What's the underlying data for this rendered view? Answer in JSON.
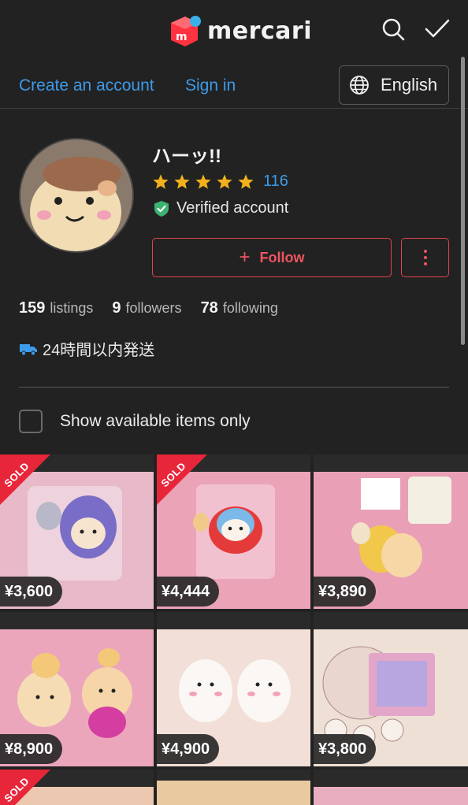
{
  "header": {
    "brand": "mercari",
    "icons": [
      "search-icon",
      "checkmark-icon"
    ]
  },
  "auth": {
    "create_account": "Create an account",
    "sign_in": "Sign in",
    "language": "English"
  },
  "profile": {
    "username": "ハーッ!!",
    "rating_stars": 5,
    "rating_count": "116",
    "verified": "Verified account",
    "follow": "Follow",
    "stats": {
      "listings_num": "159",
      "listings_label": "listings",
      "followers_num": "9",
      "followers_label": "followers",
      "following_num": "78",
      "following_label": "following"
    },
    "shipping": "24時間以内発送"
  },
  "filter": {
    "available_only": "Show available items only"
  },
  "colors": {
    "accent_blue": "#3d9be9",
    "follow_red": "#e0434f",
    "star_gold": "#f2b01e",
    "verified_green": "#3cb371",
    "brand_red": "#ff333f"
  },
  "items": [
    {
      "price": "¥3,600",
      "sold": true,
      "sold_label": "SOLD"
    },
    {
      "price": "¥4,444",
      "sold": true,
      "sold_label": "SOLD"
    },
    {
      "price": "¥3,890",
      "sold": false
    },
    {
      "price": "¥8,900",
      "sold": false
    },
    {
      "price": "¥4,900",
      "sold": false
    },
    {
      "price": "¥3,800",
      "sold": false
    },
    {
      "price": "",
      "sold": true,
      "sold_label": "SOLD"
    },
    {
      "price": "",
      "sold": false
    },
    {
      "price": "",
      "sold": false
    }
  ]
}
